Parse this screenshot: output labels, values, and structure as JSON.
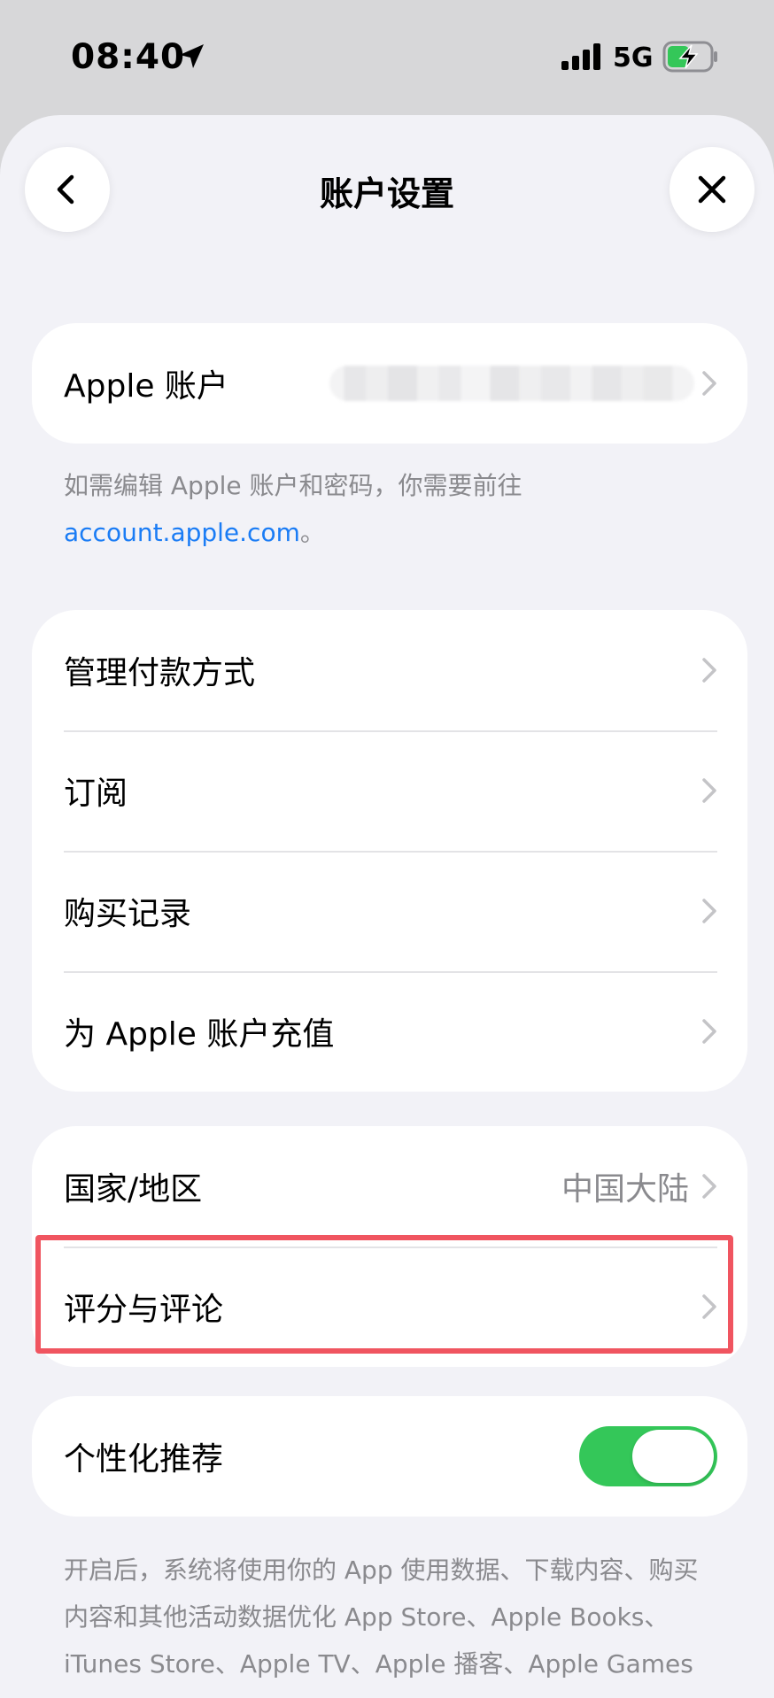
{
  "status_bar": {
    "time": "08:40",
    "network": "5G",
    "icons": [
      "location-arrow-icon",
      "signal-icon",
      "battery-charging-icon"
    ]
  },
  "header": {
    "title": "账户设置",
    "back_icon": "chevron-left-icon",
    "close_icon": "close-icon"
  },
  "account": {
    "label": "Apple 账户",
    "footnote_text": "如需编辑 Apple 账户和密码，你需要前往",
    "footnote_link": "account.apple.com",
    "footnote_end": "。"
  },
  "manage_items": [
    {
      "label": "管理付款方式"
    },
    {
      "label": "订阅"
    },
    {
      "label": "购买记录"
    },
    {
      "label": "为 Apple 账户充值"
    }
  ],
  "country": {
    "label": "国家/地区",
    "value": "中国大陆"
  },
  "ratings": {
    "label": "评分与评论"
  },
  "personalize": {
    "label": "个性化推荐",
    "enabled": true,
    "footnote": "开启后，系统将使用你的 App 使用数据、下载内容、购买内容和其他活动数据优化 App Store、Apple Books、iTunes Store、Apple TV、Apple 播客、Apple Games 和 Apple 订阅项目中的推荐内容。"
  },
  "colors": {
    "accent_link": "#1a7cf5",
    "toggle_on": "#34c759",
    "highlight": "#f05560",
    "background": "#f2f2f7"
  }
}
